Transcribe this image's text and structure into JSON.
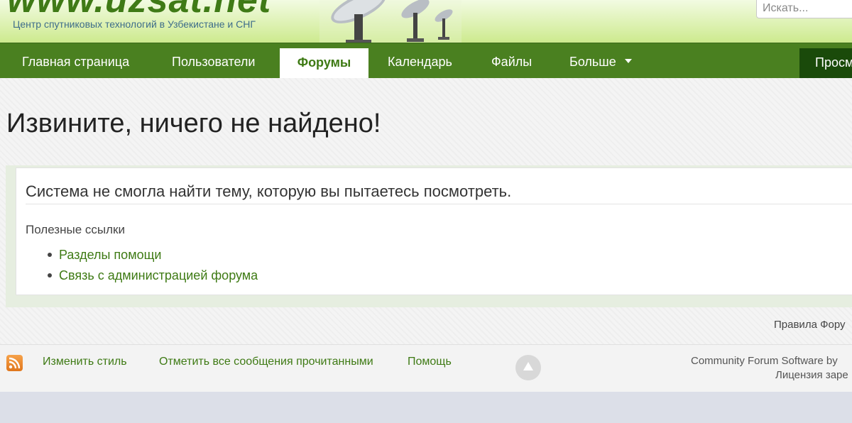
{
  "header": {
    "logo_text": "www.uzsat.net",
    "tagline": "Центр спутниковых технологий в Узбекистане и СНГ",
    "search_placeholder": "Искать..."
  },
  "nav": {
    "items": [
      {
        "label": "Главная страница"
      },
      {
        "label": "Пользователи"
      },
      {
        "label": "Форумы"
      },
      {
        "label": "Календарь"
      },
      {
        "label": "Файлы"
      },
      {
        "label": "Больше"
      }
    ],
    "active": "Форумы",
    "right_label": "Просм"
  },
  "main": {
    "title": "Извините, ничего не найдено!",
    "error_message": "Система не смогла найти тему, которую вы пытаетесь посмотреть.",
    "links_label": "Полезные ссылки",
    "links": [
      "Разделы помощи",
      "Связь с администрацией форума"
    ],
    "rules_link": "Правила Фору"
  },
  "footer": {
    "change_style": "Изменить стиль",
    "mark_read": "Отметить все сообщения прочитанными",
    "help": "Помощь",
    "copyright": "Community Forum Software by",
    "license": "Лицензия заре"
  },
  "colors": {
    "nav_bg": "#4a8020",
    "link": "#3e7a14",
    "nav_dark": "#1a4a0a"
  }
}
